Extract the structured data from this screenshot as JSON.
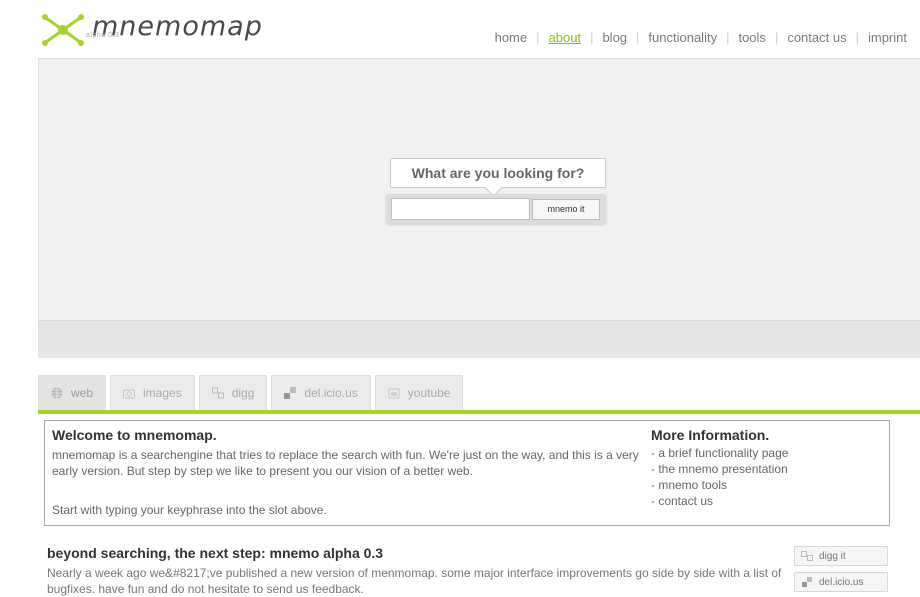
{
  "header": {
    "logo_text": "mnemomap",
    "logo_sub": "alpha 0.3",
    "nav": [
      {
        "label": "home",
        "active": false
      },
      {
        "label": "about",
        "active": true
      },
      {
        "label": "blog",
        "active": false
      },
      {
        "label": "functionality",
        "active": false
      },
      {
        "label": "tools",
        "active": false
      },
      {
        "label": "contact us",
        "active": false
      },
      {
        "label": "imprint",
        "active": false
      }
    ],
    "nav_separator": "|"
  },
  "search": {
    "prompt": "What are you looking for?",
    "input_value": "",
    "button_label": "mnemo it"
  },
  "tabs": [
    {
      "label": "web",
      "icon": "globe-icon"
    },
    {
      "label": "images",
      "icon": "camera-icon"
    },
    {
      "label": "digg",
      "icon": "digg-icon"
    },
    {
      "label": "del.icio.us",
      "icon": "delicious-icon"
    },
    {
      "label": "youtube",
      "icon": "youtube-icon"
    }
  ],
  "welcome": {
    "title": "Welcome to mnemomap.",
    "description": "mnemomap is a searchengine that tries to replace the search with fun. We're just on the way, and this is a very early version. But step by step we like to present you our vision of a better web.",
    "start_text": "Start with typing your keyphrase into the slot above.",
    "more_title": "More Information.",
    "more_links": [
      "- a brief functionality page",
      "- the mnemo presentation",
      "- mnemo tools",
      "- contact us"
    ]
  },
  "post": {
    "title": "beyond searching, the next step: mnemo alpha 0.3",
    "body": "Nearly a week ago we&#8217;ve published a new version of menmomap. some major interface improvements go side by side with a list of bugfixes. have fun and do not hesitate to send us feedback.",
    "share_digg": "digg it",
    "share_delicious": "del.icio.us"
  },
  "colors": {
    "accent": "#a6d22a",
    "nav_active": "#8bbb16"
  }
}
